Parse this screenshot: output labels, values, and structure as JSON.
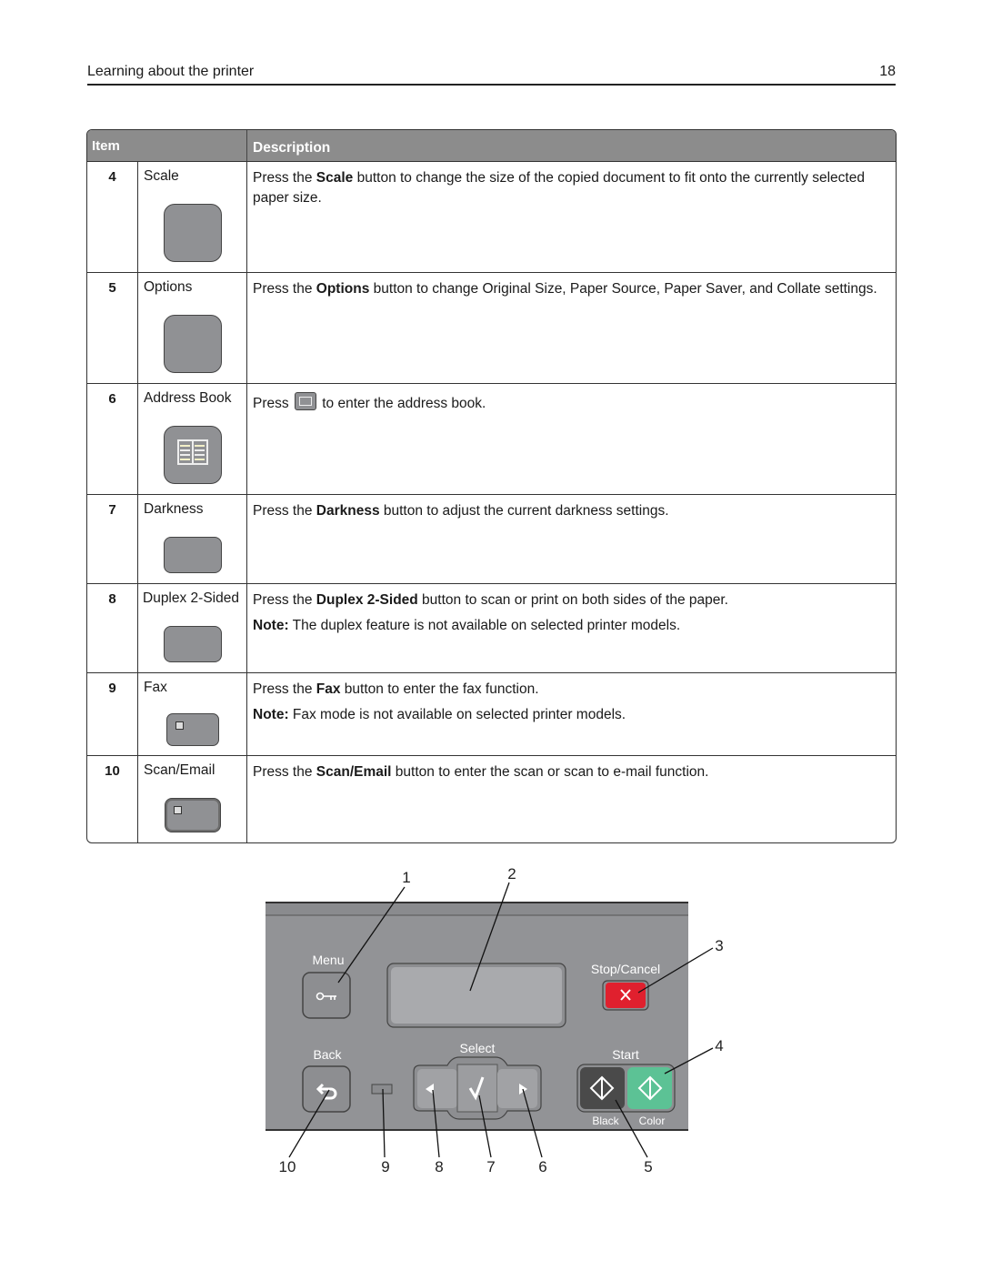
{
  "header": {
    "title": "Learning about the printer",
    "page_number": "18"
  },
  "table": {
    "columns": [
      "Item",
      "Description"
    ],
    "rows": [
      {
        "num": "4",
        "name": "Scale",
        "icon": "scale-button-icon",
        "desc": [
          {
            "pre": "Press the ",
            "bold": "Scale",
            "post": " button to change the size of the copied document to fit onto the currently selected paper size."
          }
        ]
      },
      {
        "num": "5",
        "name": "Options",
        "icon": "options-button-icon",
        "desc": [
          {
            "pre": "Press the ",
            "bold": "Options",
            "post": " button to change Original Size, Paper Source, Paper Saver, and Collate settings."
          }
        ]
      },
      {
        "num": "6",
        "name": "Address Book",
        "icon": "address-book-icon",
        "desc": [
          {
            "pre": "Press ",
            "post": " to enter the address book."
          }
        ]
      },
      {
        "num": "7",
        "name": "Darkness",
        "icon": "darkness-button-icon",
        "desc": [
          {
            "pre": "Press the ",
            "bold": "Darkness",
            "post": " button to adjust the current darkness settings."
          }
        ]
      },
      {
        "num": "8",
        "name": "Duplex 2-Sided",
        "icon": "duplex-button-icon",
        "desc": [
          {
            "pre": "Press the ",
            "bold": "Duplex 2-Sided",
            "post": " button to scan or print on both sides of the paper."
          },
          {
            "pre": "",
            "bold": "Note:",
            "post": " The duplex feature is not available on selected printer models."
          }
        ]
      },
      {
        "num": "9",
        "name": "Fax",
        "icon": "fax-button-icon",
        "desc": [
          {
            "pre": "Press the ",
            "bold": "Fax",
            "post": " button to enter the fax function."
          },
          {
            "pre": "",
            "bold": "Note:",
            "post": " Fax mode is not available on selected printer models."
          }
        ]
      },
      {
        "num": "10",
        "name": "Scan/Email",
        "icon": "scan-email-button-icon",
        "desc": [
          {
            "pre": "Press the ",
            "bold": "Scan/Email",
            "post": " button to enter the scan or scan to e-mail function."
          }
        ]
      }
    ]
  },
  "panel": {
    "labels": {
      "menu": "Menu",
      "stop_cancel": "Stop/Cancel",
      "back": "Back",
      "select": "Select",
      "start": "Start",
      "black": "Black",
      "color": "Color"
    },
    "callouts": [
      "1",
      "2",
      "3",
      "4",
      "5",
      "6",
      "7",
      "8",
      "9",
      "10"
    ],
    "colors": {
      "panel": "#929396",
      "stop": "#e0202e",
      "start_black": "#4a4a4a",
      "start_color": "#5cc295",
      "display": "#a9aaad"
    }
  }
}
